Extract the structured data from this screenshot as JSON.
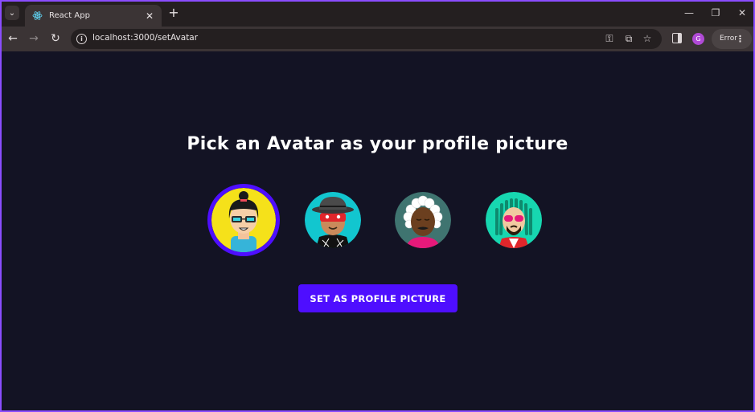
{
  "browser": {
    "tab_title": "React App",
    "url": "localhost:3000/setAvatar",
    "profile_initial": "G",
    "error_label": "Error"
  },
  "page": {
    "heading": "Pick an Avatar as your profile picture",
    "button_label": "SET AS PROFILE PICTURE",
    "selected_avatar_index": 0,
    "accent_color": "#4e0eff",
    "background_color": "#131324",
    "avatars": [
      {
        "name": "avatar-yellow-sunglasses",
        "bg": "#f5e11a"
      },
      {
        "name": "avatar-hat-mask",
        "bg": "#12c6cf"
      },
      {
        "name": "avatar-white-hair",
        "bg": "#3f7470"
      },
      {
        "name": "avatar-dreadlocks",
        "bg": "#17d7b0"
      }
    ]
  }
}
